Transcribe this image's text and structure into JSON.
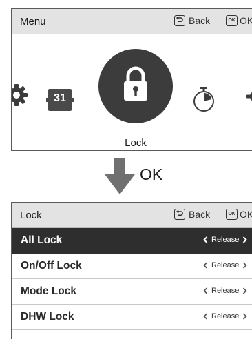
{
  "menu_screen": {
    "title": "Menu",
    "back_label": "Back",
    "ok_icon_text": "OK",
    "ok_label": "OK",
    "selected_item_label": "Lock",
    "calendar_icon_text": "31",
    "carousel_icons": [
      "gear-icon",
      "calendar-icon",
      "lock-icon",
      "timer-icon",
      "gear-icon"
    ]
  },
  "transition": {
    "label": "OK",
    "icon": "arrow-down-icon"
  },
  "lock_screen": {
    "title": "Lock",
    "back_label": "Back",
    "ok_icon_text": "OK",
    "ok_label": "OK",
    "items": [
      {
        "label": "All Lock",
        "value": "Release"
      },
      {
        "label": "On/Off Lock",
        "value": "Release"
      },
      {
        "label": "Mode Lock",
        "value": "Release"
      },
      {
        "label": "DHW Lock",
        "value": "Release"
      }
    ],
    "selected_index": 0
  },
  "colors": {
    "header_bg": "#e3e3e3",
    "selected_bg": "#2e2e2e",
    "icon_dark": "#3c3c3c",
    "arrow": "#707070"
  }
}
